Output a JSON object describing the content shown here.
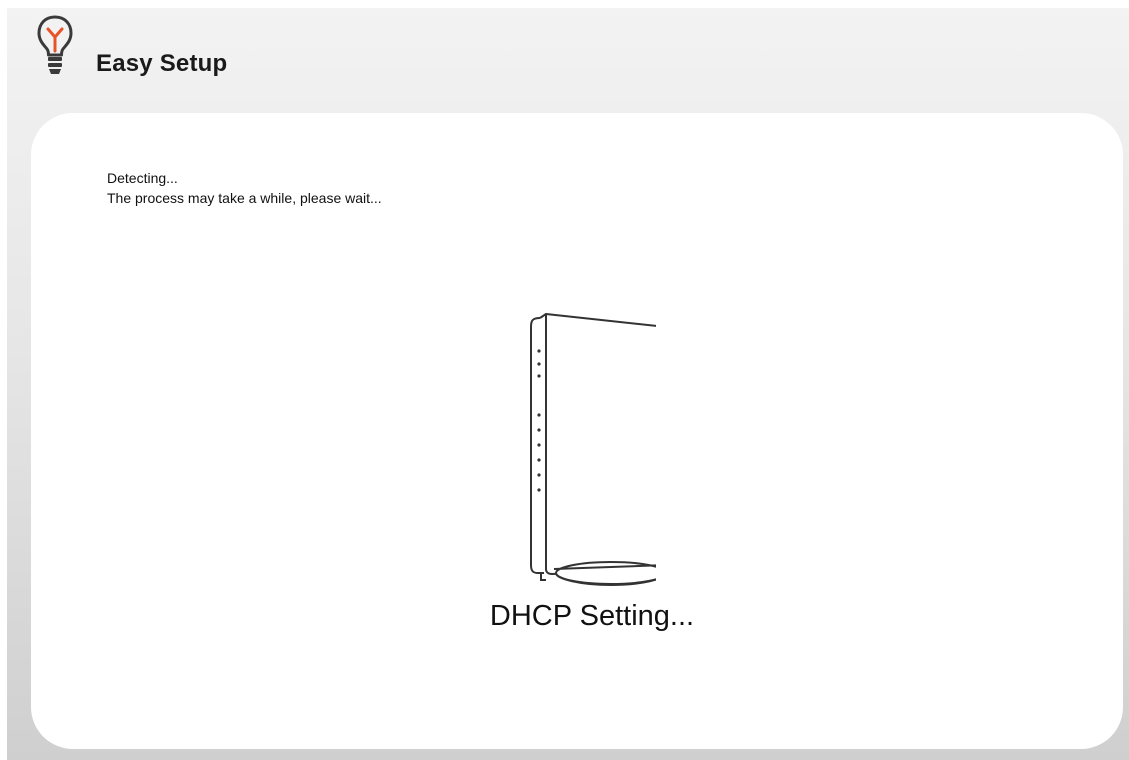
{
  "header": {
    "title": "Easy Setup",
    "icon": "lightbulb-icon",
    "accent_color": "#e8542a"
  },
  "main": {
    "message_line1": "Detecting...",
    "message_line2": "The process may take a while, please wait...",
    "device_image": "router-device-illustration",
    "status_text": "DHCP Setting..."
  }
}
